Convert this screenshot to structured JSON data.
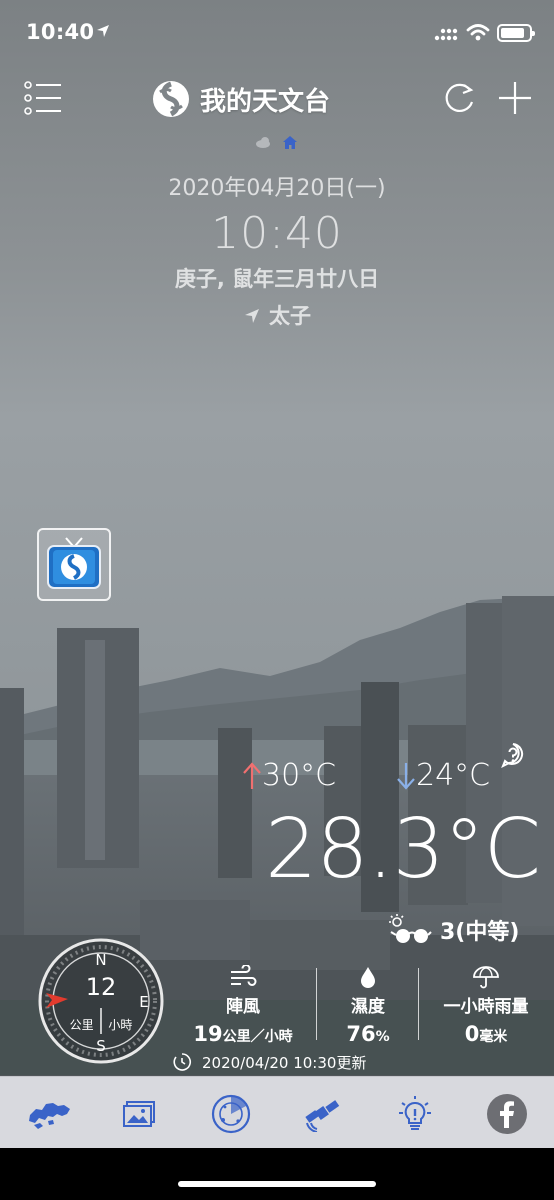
{
  "status_bar": {
    "time": "10:40",
    "icons": [
      "location-arrow-icon",
      "signal-icon",
      "wifi-icon",
      "battery-icon"
    ]
  },
  "header": {
    "title": "我的天文台",
    "menu_icon": "list-menu-icon",
    "logo_icon": "hko-logo-icon",
    "refresh_icon": "refresh-icon",
    "add_icon": "plus-icon"
  },
  "page_indicator": {
    "items": [
      "cloud-icon",
      "home-icon"
    ],
    "active_index": 1
  },
  "datetime": {
    "date": "2020年04月20日(一)",
    "time": "10:40",
    "lunar": "庚子, 鼠年三月廿八日",
    "location": "太子"
  },
  "weather": {
    "high": "30°C",
    "low": "24°C",
    "current_temp": "28.3°C",
    "uv_index": "3(中等)",
    "wind": {
      "direction_n": "N",
      "direction_e": "E",
      "direction_s": "S",
      "speed": "12",
      "unit": "公里 │ 小時"
    },
    "stats": [
      {
        "icon": "wind-icon",
        "label": "陣風",
        "value": "19",
        "unit": "公里／小時"
      },
      {
        "icon": "humidity-drop-icon",
        "label": "濕度",
        "value": "76",
        "unit": "%"
      },
      {
        "icon": "umbrella-icon",
        "label": "一小時雨量",
        "value": "0",
        "unit": "毫米"
      }
    ],
    "updated": "2020/04/20 10:30更新"
  },
  "tabbar": {
    "tabs": [
      "hk-map-icon",
      "gallery-icon",
      "radar-icon",
      "satellite-icon",
      "tips-bulb-icon",
      "facebook-icon"
    ]
  },
  "colors": {
    "accent_blue": "#3a63c8",
    "high_arrow": "#f07070",
    "low_arrow": "#8ab0e8",
    "tabbar_bg": "#d8d9de"
  }
}
